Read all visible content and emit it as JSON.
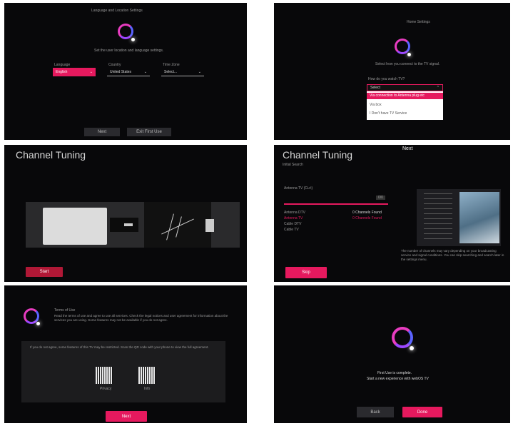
{
  "panel1": {
    "heading": "Language and Location Settings",
    "subtitle": "Set the user location and language settings.",
    "language_label": "Language",
    "language_value": "English",
    "country_label": "Country",
    "country_value": "United States",
    "timezone_label": "Time Zone",
    "timezone_value": "Select...",
    "next_label": "Next",
    "exit_label": "Exit First Use"
  },
  "panel2": {
    "heading": "Home Settings",
    "subtitle": "Select how you connect to the TV signal.",
    "question": "How do you watch TV?",
    "select_value": "Select",
    "options": [
      "Via connection to Antenna plug etc",
      "Via box",
      "I Don't have TV Service"
    ]
  },
  "panel3": {
    "title": "Channel Tuning",
    "start_label": "Start"
  },
  "panel4": {
    "title": "Channel Tuning",
    "subtitle": "Initial Search",
    "next_overlay": "Next",
    "status": "Antenna TV (Cu t)",
    "rows": [
      "Antenna DTV",
      "Antenna TV",
      "Cable DTV",
      "Cable TV"
    ],
    "found": [
      "0 Channels Found",
      "0 Channels Found"
    ],
    "count_badge": "0/0",
    "note": "The number of channels may vary depending on your broadcasting service and signal conditions. You can skip searching and search later in the settings menu.",
    "skip_label": "Skip"
  },
  "panel5": {
    "heading": "Terms of Use",
    "body": "Read the terms of use and agree to use all services. Check the legal notices and user agreement for information about the services you are using. Some features may not be available if you do not agree.",
    "box_text": "If you do not agree, some features of this TV may be restricted. Scan the QR code with your phone to view the full agreement.",
    "qr1": "Privacy",
    "qr2": "Info",
    "next_label": "Next"
  },
  "panel6": {
    "line1": "First Use is complete.",
    "line2": "Start a new experience with webOS TV",
    "back_label": "Back",
    "done_label": "Done"
  },
  "colors": {
    "accent": "#e6195e",
    "ring": "#e83cc0",
    "background": "#08080a"
  }
}
